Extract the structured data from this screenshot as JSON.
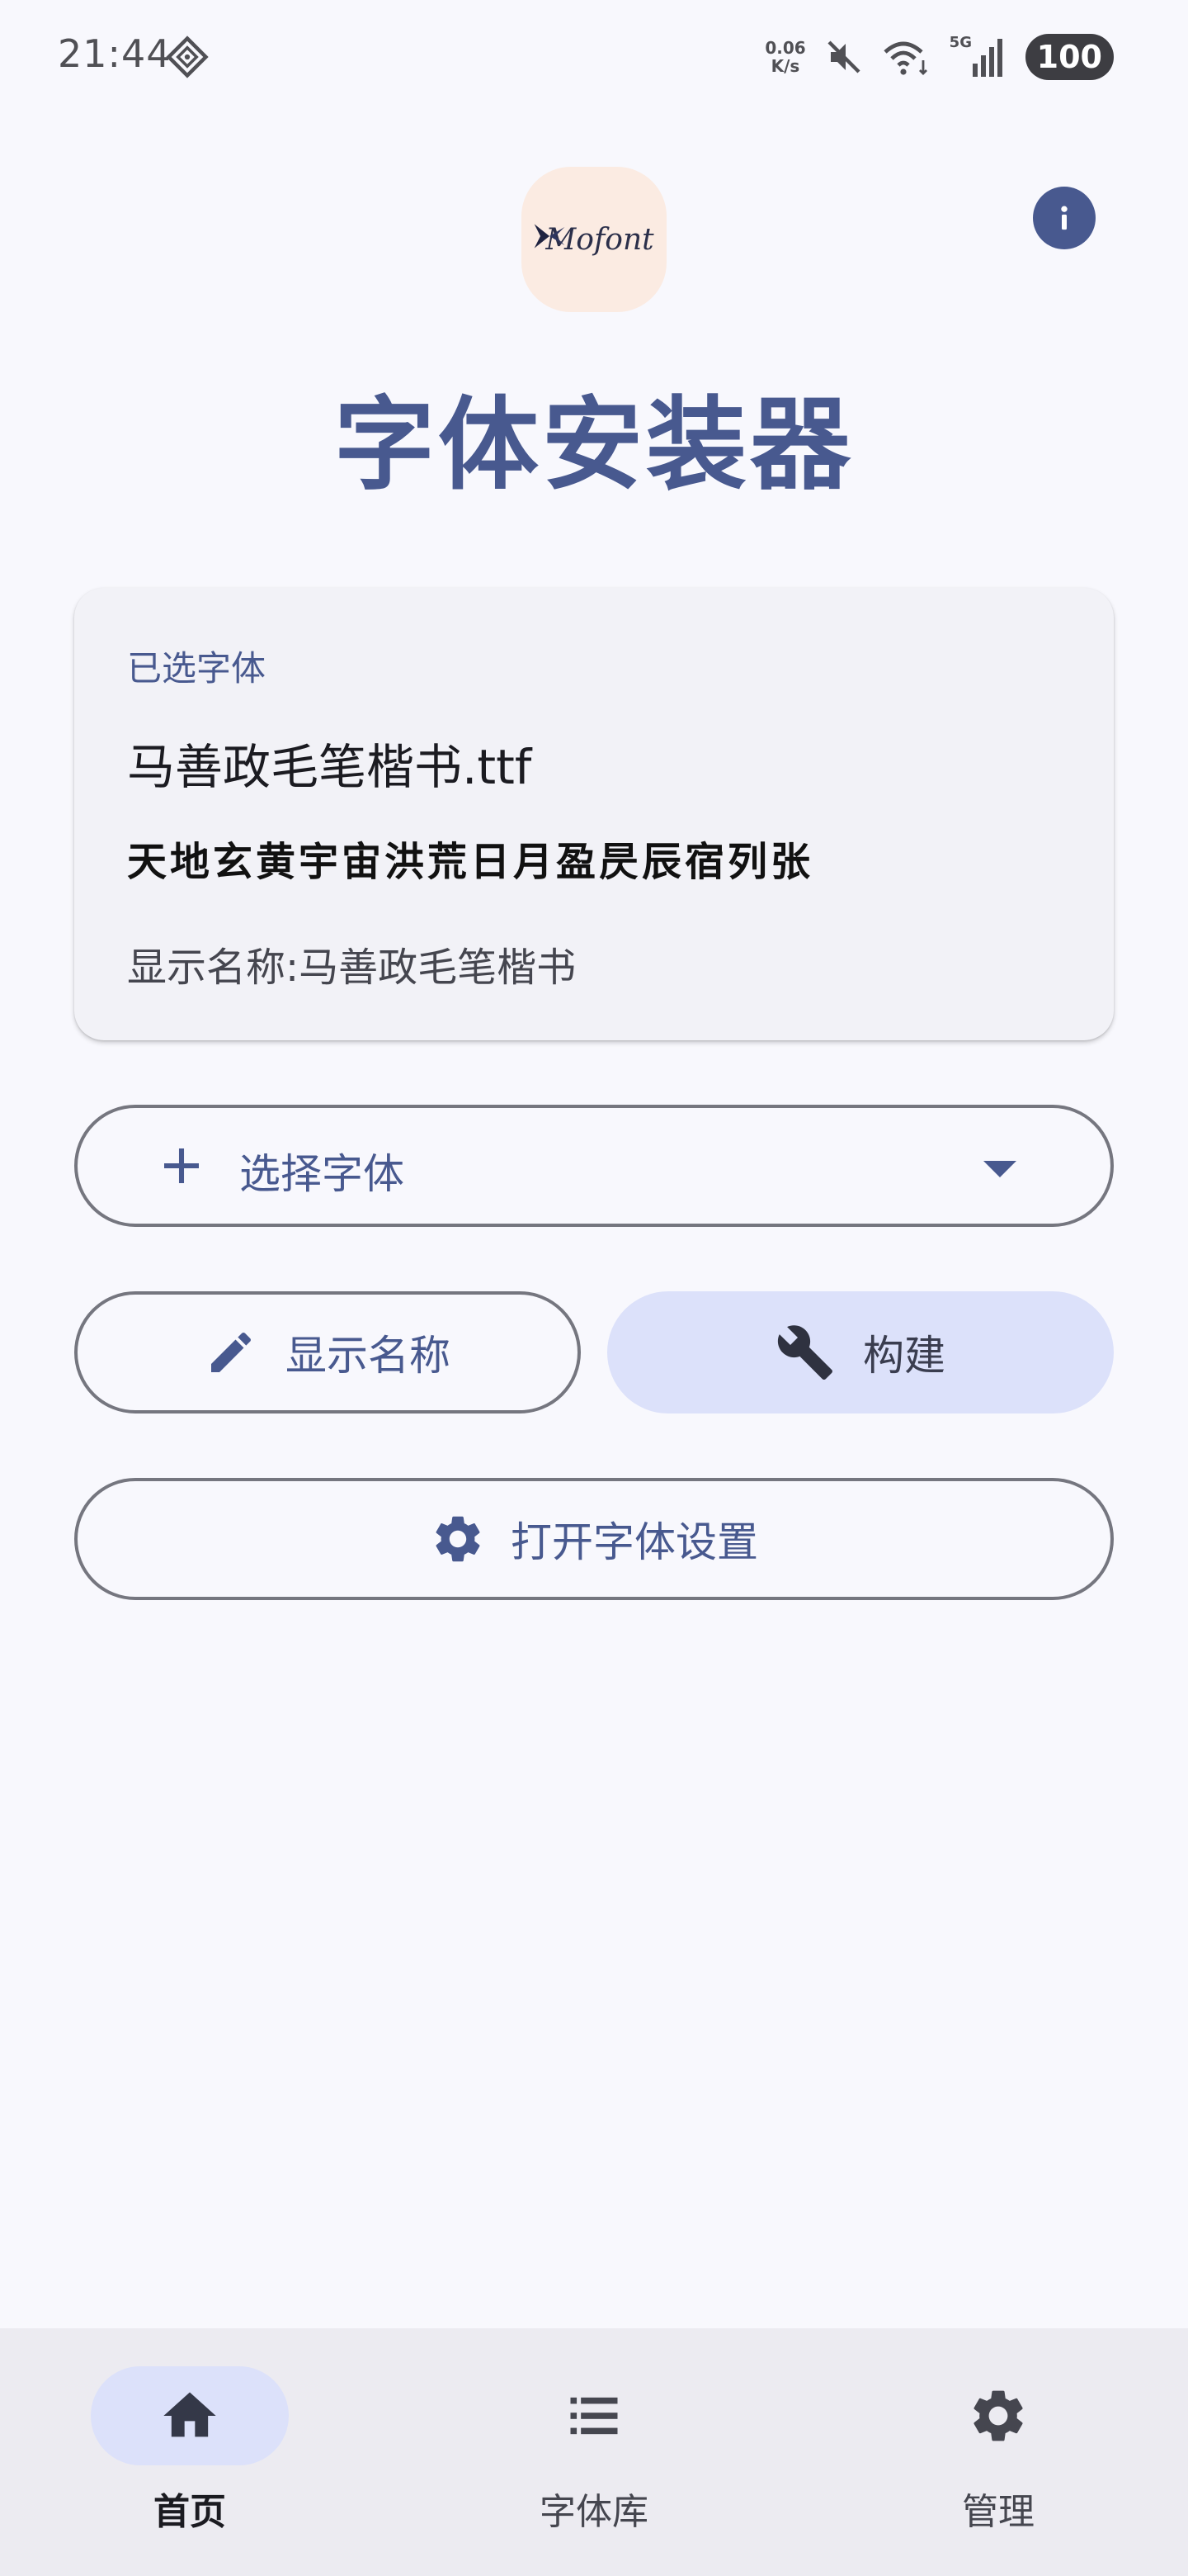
{
  "status_bar": {
    "time": "21:44",
    "net_speed_value": "0.06",
    "net_speed_unit": "K/s",
    "network": "5G",
    "battery": "100"
  },
  "header": {
    "logo_text": "Mofont",
    "title": "字体安装器"
  },
  "font_card": {
    "label": "已选字体",
    "filename": "马善政毛笔楷书.ttf",
    "preview": "天地玄黄宇宙洪荒日月盈昃辰宿列张",
    "display_name": "显示名称:马善政毛笔楷书"
  },
  "buttons": {
    "select_font": "选择字体",
    "display_name": "显示名称",
    "build": "构建",
    "open_settings": "打开字体设置"
  },
  "bottom_nav": {
    "items": [
      {
        "label": "首页",
        "icon": "home-icon",
        "active": true
      },
      {
        "label": "字体库",
        "icon": "list-icon",
        "active": false
      },
      {
        "label": "管理",
        "icon": "gear-icon",
        "active": false
      }
    ]
  },
  "colors": {
    "primary": "#48598f",
    "background": "#f8f8fd",
    "card": "#f2f2f7",
    "tonal": "#dce1fa",
    "nav_bar": "#ecebf1"
  }
}
